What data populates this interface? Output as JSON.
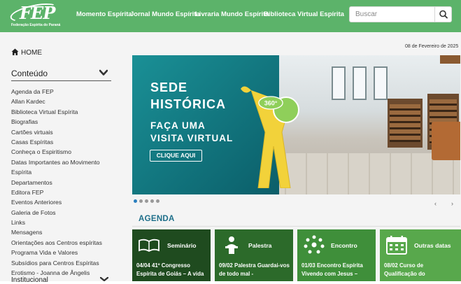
{
  "header": {
    "logo_text": "FEP",
    "logo_sub": "Federação Espírita do Paraná",
    "nav": [
      "Momento Espírita",
      "Jornal Mundo Espírita",
      "Livraria Mundo Espírita",
      "Biblioteca Virtual Espírita"
    ],
    "search_placeholder": "Buscar",
    "colors": {
      "bar": "#5cb36a"
    }
  },
  "sidebar": {
    "home_label": "HOME",
    "section_title": "Conteúdo",
    "items": [
      "Agenda da FEP",
      "Allan Kardec",
      "Biblioteca Virtual Espírita",
      "Biografias",
      "Cartões virtuais",
      "Casas Espíritas",
      "Conheça o Espiritismo",
      "Datas Importantes ao Movimento Espírita",
      "Departamentos",
      "Editora FEP",
      "Eventos Anteriores",
      "Galeria de Fotos",
      "Links",
      "Mensagens",
      "Orientações aos Centros espíritas",
      "Programa Vida e Valores",
      "Subsídios para Centros Espíritas",
      "Erotismo - Joanna de Ângelis"
    ],
    "footer_partial": "Institucional"
  },
  "main": {
    "date": "08 de Fevereiro de 2025",
    "banner": {
      "line1": "SEDE",
      "line2": "HISTÓRICA",
      "line3": "FAÇA UMA",
      "line4": "VISITA VIRTUAL",
      "cta": "CLIQUE AQUI",
      "badge": "360°"
    },
    "carousel": {
      "count": 5,
      "active": 1,
      "prev": "‹",
      "next": "›"
    },
    "agenda": {
      "title": "AGENDA",
      "cards": [
        {
          "icon": "open-book-icon",
          "title": "Seminário",
          "desc": "04/04 41º Congresso Espírita de Goiás – A vida",
          "color": "#1f4b1f"
        },
        {
          "icon": "speaker-lectern-icon",
          "title": "Palestra",
          "desc": "09/02 Palestra Guardai-vos de todo mal -",
          "color": "#2c6a2a"
        },
        {
          "icon": "people-circle-icon",
          "title": "Encontro",
          "desc": "01/03 Encontro Espírita Vivendo com Jesus –",
          "color": "#3f8f3a"
        },
        {
          "icon": "calendar-icon",
          "title": "Outras datas",
          "desc": "08/02 Curso de Qualificação do",
          "color": "#58a84c"
        }
      ]
    }
  }
}
